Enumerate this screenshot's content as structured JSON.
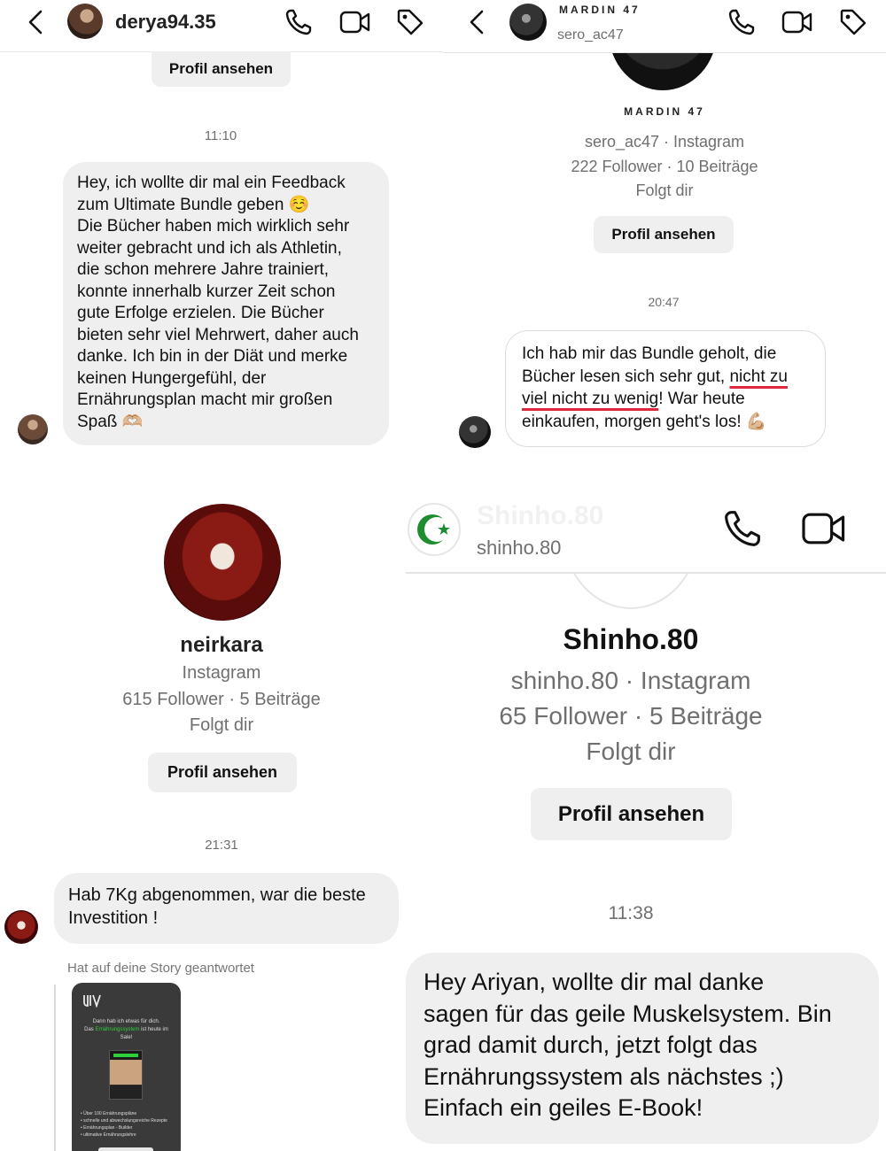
{
  "panel1": {
    "username": "derya94.35",
    "profile_button": "Profil ansehen",
    "timestamp": "11:10",
    "message_lines": [
      "Hey, ich wollte dir mal ein Feedback",
      "zum Ultimate Bundle geben ☺️",
      "Die Bücher haben mich wirklich sehr",
      "weiter gebracht und ich als Athletin,",
      "die schon mehrere Jahre trainiert,",
      "konnte innerhalb kurzer Zeit schon",
      "gute Erfolge erzielen. Die Bücher",
      "bieten sehr viel Mehrwert, daher auch",
      "danke. Ich bin in der Diät und merke",
      "keinen Hungergefühl, der",
      "Ernährungsplan macht mir großen",
      "Spaß 🫶🏼"
    ]
  },
  "panel2": {
    "display_name": "MARDIN 47",
    "username": "sero_ac47",
    "profile_name": "MARDIN 47",
    "meta_line1": "sero_ac47 · Instagram",
    "meta_line2": "222 Follower · 10 Beiträge",
    "meta_line3": "Folgt dir",
    "profile_button": "Profil ansehen",
    "timestamp": "20:47",
    "message": {
      "l1": "Ich hab mir das Bundle geholt, die",
      "l2a": "Bücher lesen sich sehr gut, ",
      "l2b": "nicht zu",
      "l3a": "viel nicht zu wenig",
      "l3b": "! War heute",
      "l4": "einkaufen, morgen geht's los! 💪🏼"
    }
  },
  "panel3": {
    "profile_name": "neirkara",
    "meta_line1": "Instagram",
    "meta_line2": "615 Follower · 5 Beiträge",
    "meta_line3": "Folgt dir",
    "profile_button": "Profil ansehen",
    "timestamp": "21:31",
    "message_lines": [
      "Hab 7Kg abgenommen, war die beste",
      "Investition !"
    ],
    "story_reply_label": "Hat auf deine Story geantwortet",
    "story_card": {
      "line1": "Dann hab ich etwas für dich.",
      "line2a": "Das ",
      "line2b": "Ernährungssystem",
      "line2c": " ist heute im",
      "line3": "Sale!",
      "bullets": [
        "• Über 100 Ernährungspläne",
        "• schnelle und abwechslungsreiche Rezepte",
        "• Ernährungsplan - Builder",
        "• ultimative Ernährungslehre"
      ]
    }
  },
  "panel4": {
    "header_name": "Shinho.80",
    "header_username": "shinho.80",
    "profile_name": "Shinho.80",
    "meta_line1": "shinho.80 · Instagram",
    "meta_line2": "65 Follower · 5 Beiträge",
    "meta_line3": "Folgt dir",
    "profile_button": "Profil ansehen",
    "timestamp": "11:38",
    "message_lines": [
      "Hey Ariyan, wollte dir mal danke",
      "sagen für das geile Muskelsystem. Bin",
      "grad damit durch, jetzt folgt das",
      "Ernährungssystem als nächstes ;)",
      "Einfach ein geiles E-Book!"
    ]
  },
  "icons": {
    "back": "chevron-left-icon",
    "call": "phone-icon",
    "video": "video-camera-icon",
    "tag": "tag-icon",
    "avatar_crescent": "crescent-star-icon"
  },
  "colors": {
    "bubble_bg": "#efefef",
    "underline_red": "#e0283c",
    "crescent_green": "#1e8c2f",
    "story_green": "#2fcf3a"
  }
}
